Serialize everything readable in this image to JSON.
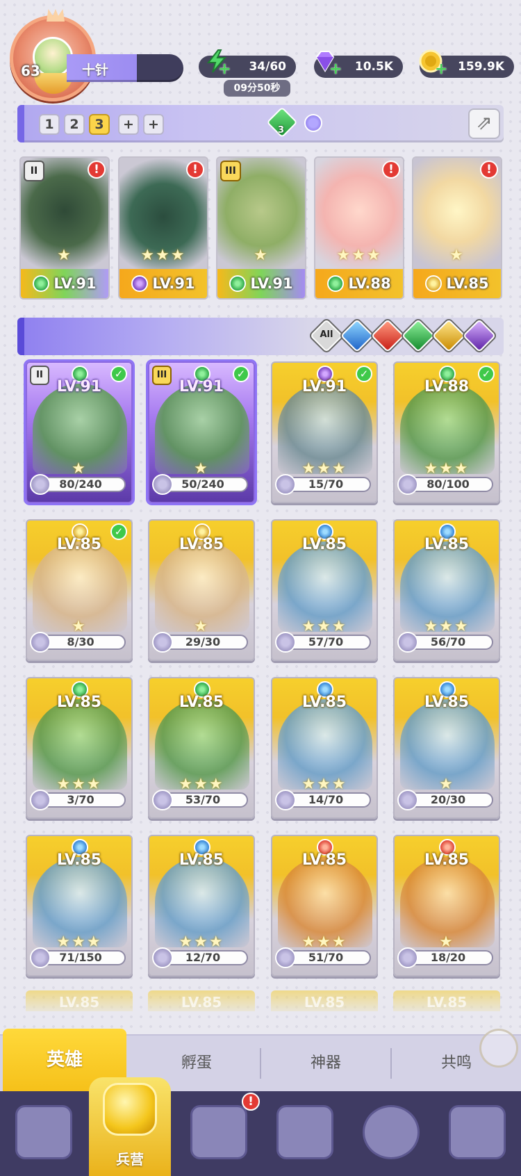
{
  "player": {
    "level": "63",
    "name": "十针"
  },
  "resources": {
    "stamina": "34/60",
    "stamina_timer": "09分50秒",
    "gems": "10.5K",
    "gold": "159.9K"
  },
  "team": {
    "slots": [
      "1",
      "2",
      "3",
      "+",
      "+"
    ],
    "active_slot": "3",
    "gem_count": "3",
    "members": [
      {
        "level": "LV.91",
        "element": "green",
        "tier": "II",
        "stars": "★",
        "alert": "!"
      },
      {
        "level": "LV.91",
        "element": "dark",
        "tier": "",
        "stars": "★★★",
        "alert": "!"
      },
      {
        "level": "LV.91",
        "element": "green",
        "tier": "III",
        "stars": "★",
        "alert": ""
      },
      {
        "level": "LV.88",
        "element": "green",
        "tier": "",
        "stars": "★★★",
        "alert": "!"
      },
      {
        "level": "LV.85",
        "element": "light",
        "tier": "",
        "stars": "★",
        "alert": "!"
      }
    ]
  },
  "filters": {
    "all_label": "All",
    "elements": [
      "water",
      "fire",
      "green",
      "light",
      "dark"
    ]
  },
  "heroes": [
    {
      "level": "LV.91",
      "element": "green",
      "tier": "II",
      "shards": "80/240",
      "stars": "★",
      "owned": true,
      "rarity": "purple"
    },
    {
      "level": "LV.91",
      "element": "green",
      "tier": "III",
      "shards": "50/240",
      "stars": "★",
      "owned": true,
      "rarity": "purple"
    },
    {
      "level": "LV.91",
      "element": "dark",
      "tier": "",
      "shards": "15/70",
      "stars": "★★★",
      "owned": true,
      "rarity": "gold"
    },
    {
      "level": "LV.88",
      "element": "green",
      "tier": "",
      "shards": "80/100",
      "stars": "★★★",
      "owned": true,
      "rarity": "gold"
    },
    {
      "level": "LV.85",
      "element": "light",
      "tier": "",
      "shards": "8/30",
      "stars": "★",
      "owned": true,
      "rarity": "gold"
    },
    {
      "level": "LV.85",
      "element": "light",
      "tier": "",
      "shards": "29/30",
      "stars": "★",
      "owned": false,
      "rarity": "gold"
    },
    {
      "level": "LV.85",
      "element": "water",
      "tier": "",
      "shards": "57/70",
      "stars": "★★★",
      "owned": false,
      "rarity": "gold"
    },
    {
      "level": "LV.85",
      "element": "water",
      "tier": "",
      "shards": "56/70",
      "stars": "★★★",
      "owned": false,
      "rarity": "gold"
    },
    {
      "level": "LV.85",
      "element": "green",
      "tier": "",
      "shards": "3/70",
      "stars": "★★★",
      "owned": false,
      "rarity": "gold"
    },
    {
      "level": "LV.85",
      "element": "green",
      "tier": "",
      "shards": "53/70",
      "stars": "★★★",
      "owned": false,
      "rarity": "gold"
    },
    {
      "level": "LV.85",
      "element": "water",
      "tier": "",
      "shards": "14/70",
      "stars": "★★★",
      "owned": false,
      "rarity": "gold"
    },
    {
      "level": "LV.85",
      "element": "water",
      "tier": "",
      "shards": "20/30",
      "stars": "★",
      "owned": false,
      "rarity": "gold"
    },
    {
      "level": "LV.85",
      "element": "water",
      "tier": "",
      "shards": "71/150",
      "stars": "★★★",
      "owned": false,
      "rarity": "gold"
    },
    {
      "level": "LV.85",
      "element": "water",
      "tier": "",
      "shards": "12/70",
      "stars": "★★★",
      "owned": false,
      "rarity": "gold"
    },
    {
      "level": "LV.85",
      "element": "fire",
      "tier": "",
      "shards": "51/70",
      "stars": "★★★",
      "owned": false,
      "rarity": "gold"
    },
    {
      "level": "LV.85",
      "element": "fire",
      "tier": "",
      "shards": "18/20",
      "stars": "★",
      "owned": false,
      "rarity": "gold"
    }
  ],
  "partial_row": [
    {
      "level": "LV.85",
      "element": "green"
    },
    {
      "level": "LV.85",
      "element": "green"
    },
    {
      "level": "LV.85",
      "element": "fire"
    },
    {
      "level": "LV.85",
      "element": "light"
    }
  ],
  "tabs": {
    "heroes": "英雄",
    "hatch": "孵蛋",
    "artifacts": "神器",
    "resonance": "共鸣"
  },
  "nav": {
    "active_label": "兵营",
    "alert": "!",
    "icons": [
      "cards-icon",
      "barracks-icon",
      "book-icon",
      "castle-icon",
      "mushroom-icon",
      "banner-icon"
    ]
  }
}
